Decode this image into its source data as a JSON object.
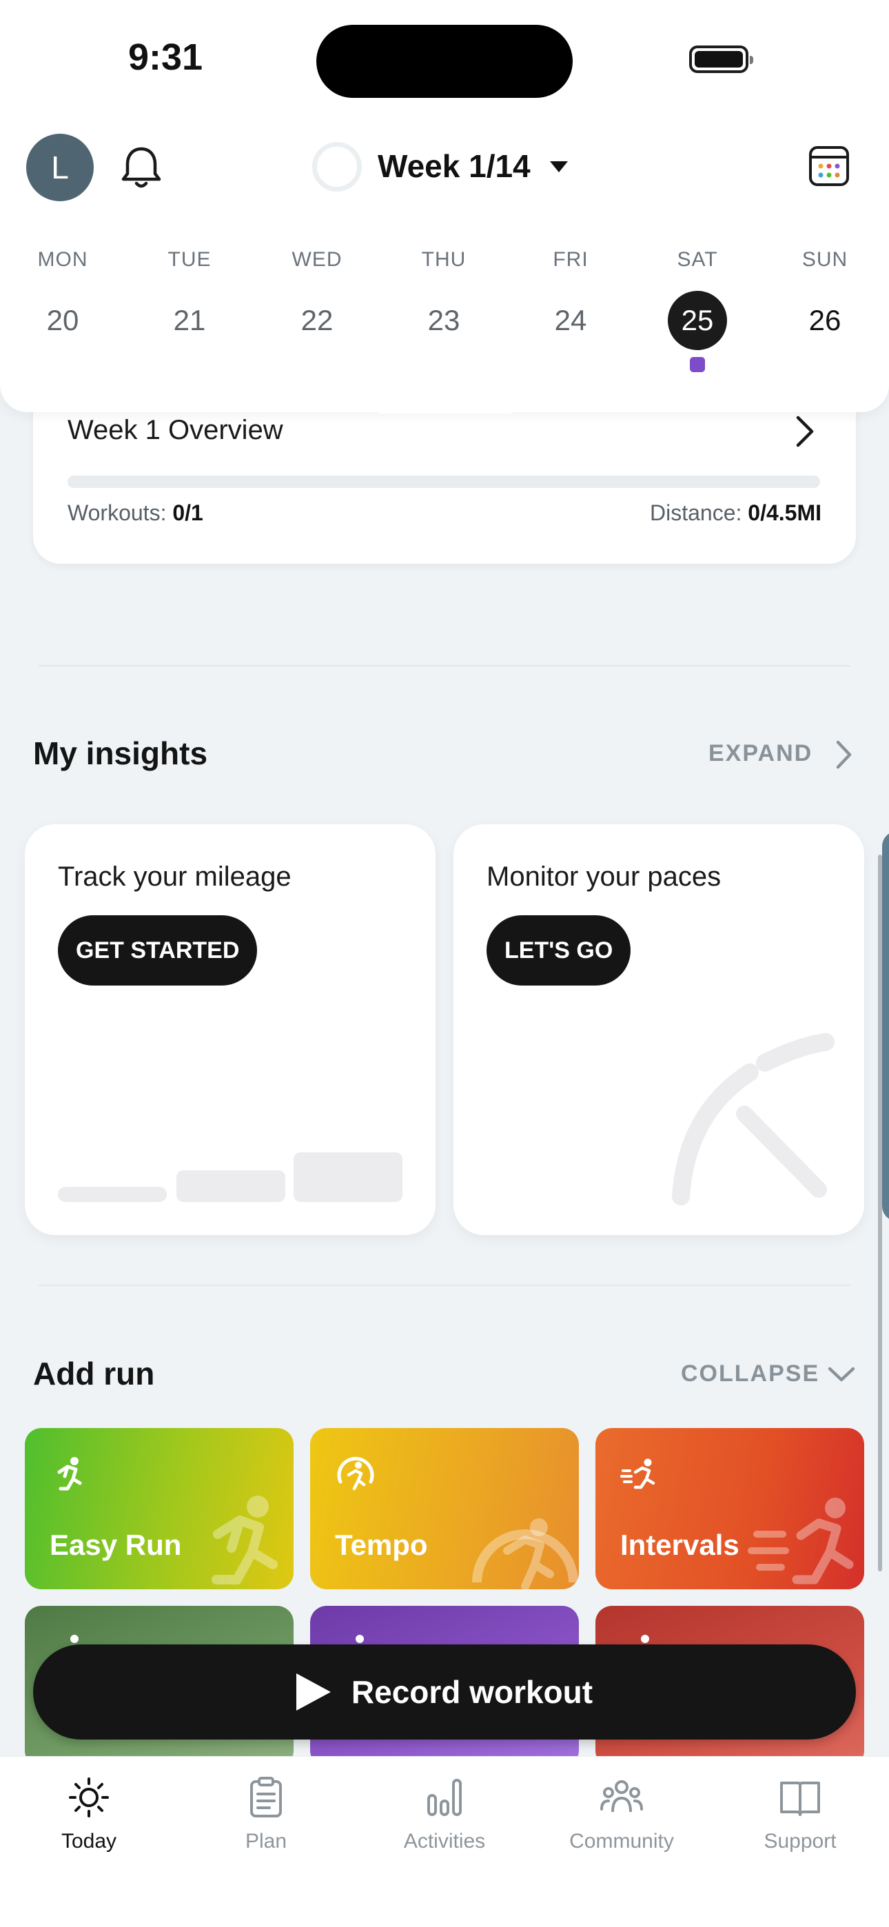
{
  "status_bar": {
    "time": "9:31"
  },
  "header": {
    "avatar_initial": "L",
    "week_title": "Week 1/14"
  },
  "week_days": [
    {
      "name": "MON",
      "num": "20",
      "state": "past"
    },
    {
      "name": "TUE",
      "num": "21",
      "state": "past"
    },
    {
      "name": "WED",
      "num": "22",
      "state": "past"
    },
    {
      "name": "THU",
      "num": "23",
      "state": "past"
    },
    {
      "name": "FRI",
      "num": "24",
      "state": "past"
    },
    {
      "name": "SAT",
      "num": "25",
      "state": "active",
      "has_workout": true
    },
    {
      "name": "SUN",
      "num": "26",
      "state": "future"
    }
  ],
  "overview": {
    "title": "Week 1 Overview",
    "progress": 0,
    "workouts_label": "Workouts:",
    "workouts_value": "0/1",
    "distance_label": "Distance:",
    "distance_value": "0/4.5MI"
  },
  "insights": {
    "title": "My insights",
    "action": "EXPAND",
    "cards": [
      {
        "title": "Track your mileage",
        "button": "GET STARTED"
      },
      {
        "title": "Monitor your paces",
        "button": "LET'S GO"
      }
    ]
  },
  "add_run": {
    "title": "Add run",
    "action": "COLLAPSE",
    "tiles": [
      {
        "label": "Easy Run",
        "icon": "runner-icon"
      },
      {
        "label": "Tempo",
        "icon": "tempo-runner-icon"
      },
      {
        "label": "Intervals",
        "icon": "intervals-runner-icon"
      },
      {
        "label": "",
        "icon": "runner-icon"
      },
      {
        "label": "",
        "icon": "runner-icon"
      },
      {
        "label": "",
        "icon": "runner-icon"
      }
    ]
  },
  "record_button": {
    "label": "Record workout"
  },
  "tabbar": {
    "items": [
      {
        "label": "Today",
        "icon": "sun-icon",
        "active": true
      },
      {
        "label": "Plan",
        "icon": "clipboard-icon"
      },
      {
        "label": "Activities",
        "icon": "bar-chart-icon"
      },
      {
        "label": "Community",
        "icon": "people-icon"
      },
      {
        "label": "Support",
        "icon": "book-icon"
      }
    ]
  },
  "colors": {
    "accent_dark": "#151515",
    "workout_dot": "#7e4bc9",
    "easy_run": "#4fbf2e",
    "tempo": "#eec713",
    "intervals": "#e25026"
  }
}
